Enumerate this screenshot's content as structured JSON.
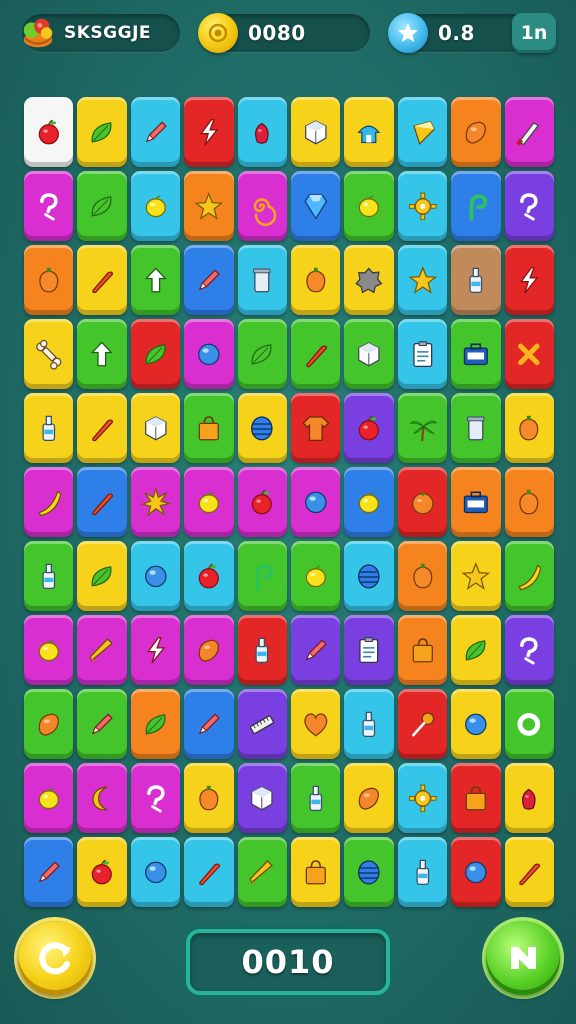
{
  "hud": {
    "player_label": "SKSGGJE",
    "coins": "0080",
    "stars": "0.8",
    "menu_label": "1n"
  },
  "score": {
    "value": "0010"
  },
  "colors": {
    "red": "#e32626",
    "orange": "#f5841e",
    "yellow": "#f7d21b",
    "green": "#43c52b",
    "cyan": "#35c5e8",
    "blue": "#2f7fe8",
    "purple": "#7a3fe0",
    "magenta": "#d92fd0",
    "white": "#f6f6f6",
    "tan": "#c08a5a"
  },
  "grid": {
    "rows": [
      [
        [
          "white",
          "apple"
        ],
        [
          "yellow",
          "leaf"
        ],
        [
          "cyan",
          "pencil"
        ],
        [
          "red",
          "bolt"
        ],
        [
          "cyan",
          "berry"
        ],
        [
          "yellow",
          "cube"
        ],
        [
          "yellow",
          "house"
        ],
        [
          "cyan",
          "ice"
        ],
        [
          "orange",
          "drop"
        ],
        [
          "magenta",
          "knife"
        ]
      ],
      [
        [
          "magenta",
          "question"
        ],
        [
          "green",
          "leaf"
        ],
        [
          "cyan",
          "lemon"
        ],
        [
          "orange",
          "star"
        ],
        [
          "magenta",
          "swirl"
        ],
        [
          "blue",
          "gem"
        ],
        [
          "green",
          "lemon"
        ],
        [
          "cyan",
          "gear"
        ],
        [
          "blue",
          "hook"
        ],
        [
          "purple",
          "question"
        ]
      ],
      [
        [
          "orange",
          "pepper"
        ],
        [
          "yellow",
          "carrot"
        ],
        [
          "green",
          "arrow"
        ],
        [
          "blue",
          "pencil"
        ],
        [
          "cyan",
          "jar"
        ],
        [
          "yellow",
          "pepper"
        ],
        [
          "yellow",
          "rock"
        ],
        [
          "cyan",
          "star"
        ],
        [
          "tan",
          "bottle"
        ],
        [
          "red",
          "bolt"
        ]
      ],
      [
        [
          "yellow",
          "bone"
        ],
        [
          "green",
          "arrow"
        ],
        [
          "red",
          "leaf"
        ],
        [
          "magenta",
          "ball"
        ],
        [
          "green",
          "leaf"
        ],
        [
          "green",
          "carrot"
        ],
        [
          "green",
          "cube"
        ],
        [
          "cyan",
          "clipboard"
        ],
        [
          "green",
          "case"
        ],
        [
          "red",
          "cross"
        ]
      ],
      [
        [
          "yellow",
          "bottle"
        ],
        [
          "yellow",
          "carrot"
        ],
        [
          "yellow",
          "cube"
        ],
        [
          "green",
          "bag"
        ],
        [
          "yellow",
          "barrel"
        ],
        [
          "red",
          "tshirt"
        ],
        [
          "purple",
          "apple"
        ],
        [
          "green",
          "palm"
        ],
        [
          "green",
          "jar"
        ],
        [
          "yellow",
          "pepper"
        ]
      ],
      [
        [
          "magenta",
          "banana"
        ],
        [
          "blue",
          "carrot"
        ],
        [
          "magenta",
          "splat"
        ],
        [
          "magenta",
          "lemon"
        ],
        [
          "magenta",
          "apple"
        ],
        [
          "magenta",
          "ball"
        ],
        [
          "blue",
          "lemon"
        ],
        [
          "red",
          "orange"
        ],
        [
          "orange",
          "case"
        ],
        [
          "orange",
          "pepper"
        ]
      ],
      [
        [
          "green",
          "bottle"
        ],
        [
          "yellow",
          "leaf"
        ],
        [
          "cyan",
          "ball"
        ],
        [
          "cyan",
          "apple"
        ],
        [
          "green",
          "hook"
        ],
        [
          "green",
          "lemon"
        ],
        [
          "cyan",
          "barrel"
        ],
        [
          "orange",
          "pepper"
        ],
        [
          "yellow",
          "star"
        ],
        [
          "green",
          "banana"
        ]
      ],
      [
        [
          "magenta",
          "lemon"
        ],
        [
          "magenta",
          "cone"
        ],
        [
          "magenta",
          "bolt"
        ],
        [
          "magenta",
          "drop"
        ],
        [
          "red",
          "bottle"
        ],
        [
          "purple",
          "pencil"
        ],
        [
          "purple",
          "clipboard"
        ],
        [
          "orange",
          "bag"
        ],
        [
          "yellow",
          "leaf"
        ],
        [
          "purple",
          "question"
        ]
      ],
      [
        [
          "green",
          "drop"
        ],
        [
          "green",
          "pencil"
        ],
        [
          "orange",
          "leaf"
        ],
        [
          "blue",
          "pencil"
        ],
        [
          "purple",
          "ruler"
        ],
        [
          "yellow",
          "heart"
        ],
        [
          "cyan",
          "bottle"
        ],
        [
          "red",
          "lollipop"
        ],
        [
          "yellow",
          "ball"
        ],
        [
          "green",
          "ring"
        ]
      ],
      [
        [
          "magenta",
          "lemon"
        ],
        [
          "magenta",
          "moon"
        ],
        [
          "magenta",
          "question"
        ],
        [
          "yellow",
          "pepper"
        ],
        [
          "purple",
          "cube"
        ],
        [
          "green",
          "bottle"
        ],
        [
          "yellow",
          "drop"
        ],
        [
          "cyan",
          "gear"
        ],
        [
          "red",
          "bag"
        ],
        [
          "yellow",
          "berry"
        ]
      ],
      [
        [
          "blue",
          "pencil"
        ],
        [
          "yellow",
          "apple"
        ],
        [
          "cyan",
          "ball"
        ],
        [
          "cyan",
          "carrot"
        ],
        [
          "green",
          "cone"
        ],
        [
          "yellow",
          "bag"
        ],
        [
          "green",
          "barrel"
        ],
        [
          "cyan",
          "bottle"
        ],
        [
          "red",
          "ball"
        ],
        [
          "yellow",
          "carrot"
        ]
      ]
    ]
  }
}
